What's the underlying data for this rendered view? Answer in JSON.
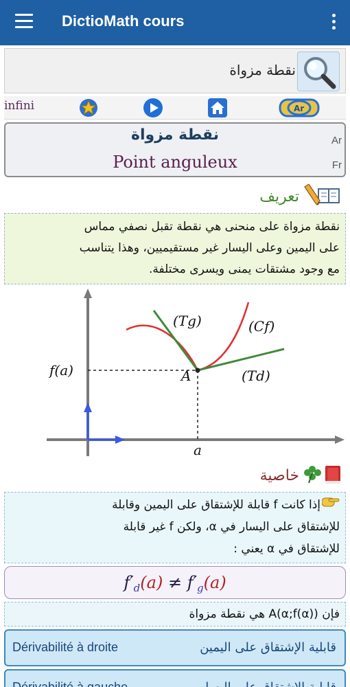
{
  "app": {
    "title": "DictioMath cours"
  },
  "search": {
    "query": "نقطة مزواة"
  },
  "toolbar": {
    "infini": "infini"
  },
  "term": {
    "ar": "نقطة مزواة",
    "fr": "Point anguleux",
    "ar_tag": "Ar",
    "fr_tag": "Fr"
  },
  "definition": {
    "heading": "تعريف",
    "lines": [
      "نقطة مزواة على منحنى هي نقطة تقبل نصفي مماس",
      "على اليمين وعلى اليسار غير مستقيميين، وهذا يتناسب",
      "مع وجود مشتقات يمنى ويسرى مختلفة."
    ]
  },
  "figure": {
    "labels": {
      "fa": "f(a)",
      "A": "A",
      "a": "a",
      "Tg": "(Tg)",
      "Cf": "(Cf)",
      "Td": "(Td)"
    }
  },
  "property": {
    "heading": "خاصية",
    "lines": [
      "إذا كانت f قابلة للإشتقاق على اليمين وقابلة",
      "للإشتقاق على اليسار في α، ولكن f غير قابلة",
      "للإشتقاق في α يعني :"
    ],
    "formula": {
      "left": "f′",
      "sub_d": "d",
      "sub_g": "g",
      "arg": "(a)",
      "neq": " ≠ "
    },
    "conclusion": "فإن A(α;f(α)) هي نقطة مزواة"
  },
  "links": [
    {
      "fr": "Dérivabilité à droite",
      "ar": "قابلية الإشتقاق على اليمين"
    },
    {
      "fr": "Dérivabilité à gauche",
      "ar": "قابلية الإشتقاق على اليسار"
    }
  ]
}
